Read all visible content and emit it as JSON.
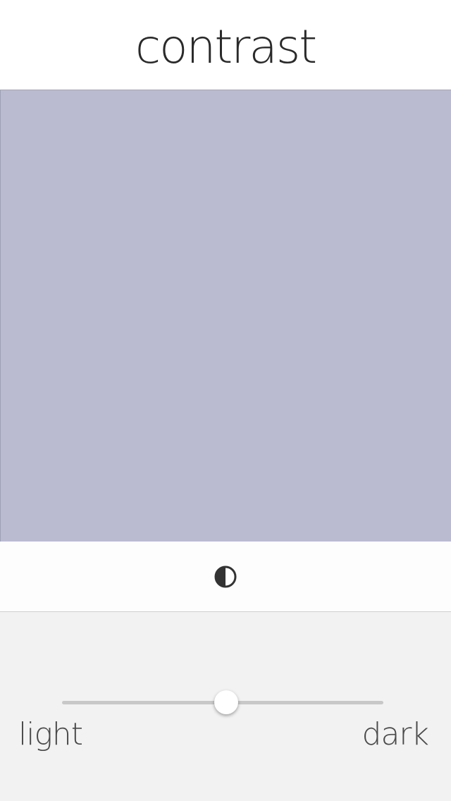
{
  "header": {
    "title": "contrast"
  },
  "swatch": {
    "color": "#babbd1"
  },
  "toolbar": {
    "icon": "contrast-icon"
  },
  "slider": {
    "value": 0.51,
    "min_label": "light",
    "max_label": "dark"
  },
  "colors": {
    "header_bg": "#ffffff",
    "controls_bg": "#f2f2f2",
    "track": "#c8c8c8",
    "text": "#2a2a2a"
  }
}
